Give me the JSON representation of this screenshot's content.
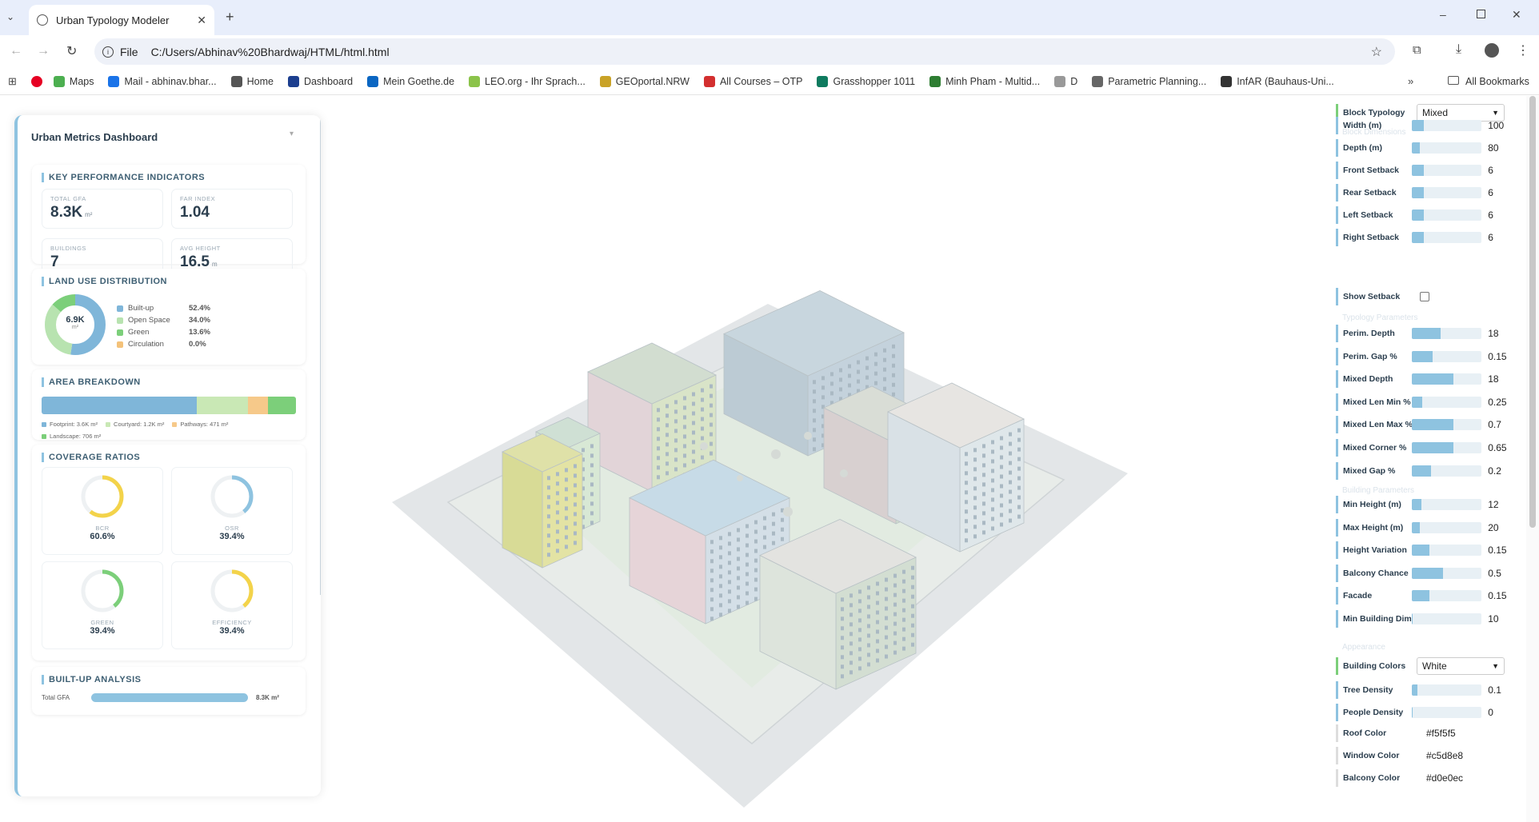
{
  "browser": {
    "tab_title": "Urban Typology Modeler",
    "url": "C:/Users/Abhinav%20Bhardwaj/HTML/html.html",
    "file_label": "File",
    "bookmarks": [
      "Maps",
      "Mail - abhinav.bhar...",
      "Home",
      "Dashboard",
      "Mein Goethe.de",
      "LEO.org - Ihr Sprach...",
      "GEOportal.NRW",
      "All Courses – OTP",
      "Grasshopper 1011",
      "Minh Pham - Multid...",
      "D",
      "Parametric Planning...",
      "InfAR (Bauhaus-Uni..."
    ],
    "all_bookmarks": "All Bookmarks"
  },
  "dashboard": {
    "title": "Urban Metrics Dashboard",
    "kpi_title": "KEY PERFORMANCE INDICATORS",
    "kpis": [
      {
        "label": "TOTAL GFA",
        "value": "8.3K",
        "unit": "m²"
      },
      {
        "label": "FAR INDEX",
        "value": "1.04",
        "unit": ""
      },
      {
        "label": "BUILDINGS",
        "value": "7",
        "unit": ""
      },
      {
        "label": "AVG HEIGHT",
        "value": "16.5",
        "unit": "m"
      }
    ],
    "landuse_title": "LAND USE DISTRIBUTION",
    "donut_value": "6.9K",
    "donut_unit": "m²",
    "landuse": [
      {
        "label": "Built-up",
        "pct": "52.4%",
        "color": "#7fb6d9"
      },
      {
        "label": "Open Space",
        "pct": "34.0%",
        "color": "#b8e3b0"
      },
      {
        "label": "Green",
        "pct": "13.6%",
        "color": "#7ccf7a"
      },
      {
        "label": "Circulation",
        "pct": "0.0%",
        "color": "#f4c27a"
      }
    ],
    "area_title": "AREA BREAKDOWN",
    "area_fractions": [
      0.61,
      0.2,
      0.08,
      0.11
    ],
    "area_legend": [
      {
        "label": "Footprint: 3.6K m²",
        "color": "#7fb6d9"
      },
      {
        "label": "Courtyard: 1.2K m²",
        "color": "#c9e8b5"
      },
      {
        "label": "Pathways: 471 m²",
        "color": "#f6c98a"
      },
      {
        "label": "Landscape: 706 m²",
        "color": "#7ccf7a"
      }
    ],
    "coverage_title": "COVERAGE RATIOS",
    "coverage": [
      {
        "label": "BCR",
        "value": "60.6%",
        "fraction": 0.606,
        "color": "#f3d34a"
      },
      {
        "label": "OSR",
        "value": "39.4%",
        "fraction": 0.394,
        "color": "#8ec3e0"
      },
      {
        "label": "GREEN",
        "value": "39.4%",
        "fraction": 0.394,
        "color": "#7ccf7a"
      },
      {
        "label": "EFFICIENCY",
        "value": "39.4%",
        "fraction": 0.394,
        "color": "#f3d34a"
      }
    ],
    "builtup_title": "BUILT-UP ANALYSIS",
    "builtup_row_label": "Total GFA",
    "builtup_row_value": "8.3K m²"
  },
  "controls": {
    "block_typology_label": "Block Typology",
    "block_typology_value": "Mixed",
    "group1": [
      {
        "label": "Width (m)",
        "value": "100",
        "fill": 0.18
      },
      {
        "label": "Depth (m)",
        "value": "80",
        "fill": 0.12
      },
      {
        "label": "Front Setback",
        "value": "6",
        "fill": 0.18
      },
      {
        "label": "Rear Setback",
        "value": "6",
        "fill": 0.18
      },
      {
        "label": "Left Setback",
        "value": "6",
        "fill": 0.18
      },
      {
        "label": "Right Setback",
        "value": "6",
        "fill": 0.18
      }
    ],
    "show_setback_label": "Show Setback",
    "group2": [
      {
        "label": "Perim. Depth",
        "value": "18",
        "fill": 0.42
      },
      {
        "label": "Perim. Gap %",
        "value": "0.15",
        "fill": 0.3
      },
      {
        "label": "Mixed Depth",
        "value": "18",
        "fill": 0.6
      },
      {
        "label": "Mixed Len Min %",
        "value": "0.25",
        "fill": 0.15
      },
      {
        "label": "Mixed Len Max %",
        "value": "0.7",
        "fill": 0.6
      },
      {
        "label": "Mixed Corner %",
        "value": "0.65",
        "fill": 0.6
      },
      {
        "label": "Mixed Gap %",
        "value": "0.2",
        "fill": 0.28
      }
    ],
    "group3": [
      {
        "label": "Min Height (m)",
        "value": "12",
        "fill": 0.14
      },
      {
        "label": "Max Height (m)",
        "value": "20",
        "fill": 0.12
      },
      {
        "label": "Height Variation",
        "value": "0.15",
        "fill": 0.26
      },
      {
        "label": "Balcony Chance",
        "value": "0.5",
        "fill": 0.45
      },
      {
        "label": "Facade",
        "value": "0.15",
        "fill": 0.26
      },
      {
        "label": "Min Building Dim",
        "value": "10",
        "fill": 0.0
      }
    ],
    "building_colors_label": "Building Colors",
    "building_colors_value": "White",
    "group4": [
      {
        "label": "Tree Density",
        "value": "0.1",
        "fill": 0.08
      },
      {
        "label": "People Density",
        "value": "0",
        "fill": 0.0
      }
    ],
    "colors": [
      {
        "label": "Roof Color",
        "value": "#f5f5f5"
      },
      {
        "label": "Window Color",
        "value": "#c5d8e8"
      },
      {
        "label": "Balcony Color",
        "value": "#d0e0ec"
      }
    ]
  }
}
